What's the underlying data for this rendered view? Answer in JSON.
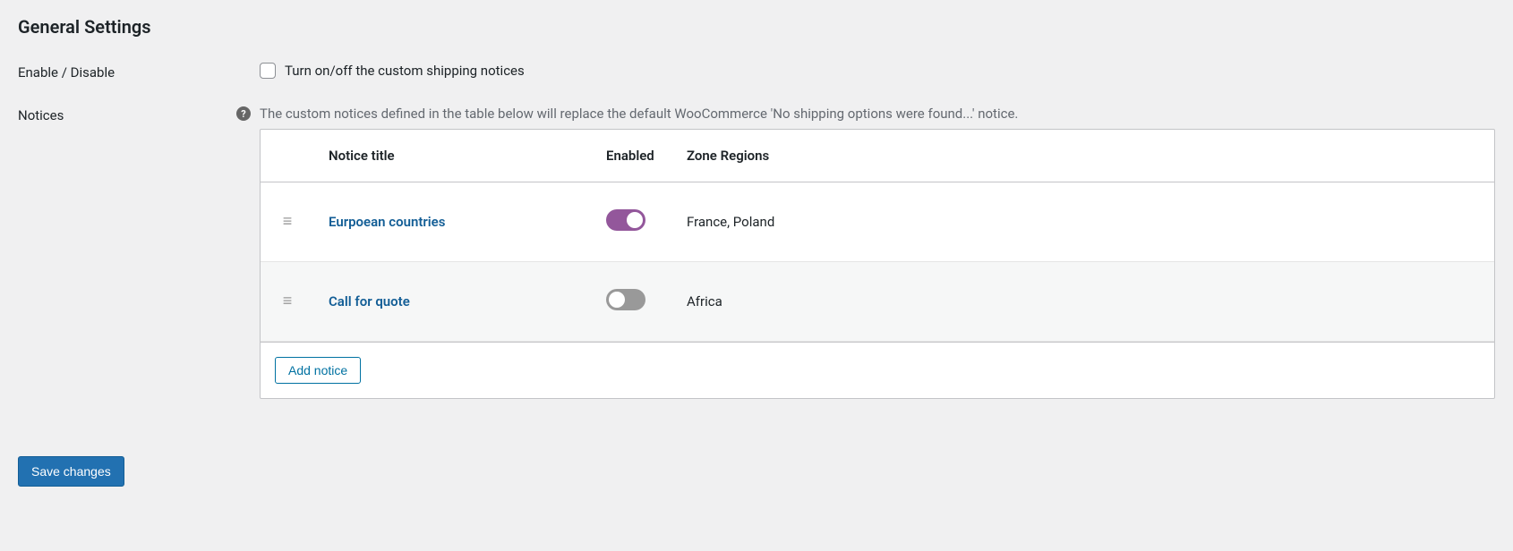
{
  "section_title": "General Settings",
  "enable_row": {
    "label": "Enable / Disable",
    "checkbox_label": "Turn on/off the custom shipping notices"
  },
  "notices_row": {
    "label": "Notices",
    "help_text": "The custom notices defined in the table below will replace the default WooCommerce 'No shipping options were found...' notice."
  },
  "table": {
    "headers": {
      "title": "Notice title",
      "enabled": "Enabled",
      "zone": "Zone Regions"
    },
    "rows": [
      {
        "title": "Eurpoean countries",
        "enabled": true,
        "zone": "France, Poland"
      },
      {
        "title": "Call for quote",
        "enabled": false,
        "zone": "Africa"
      }
    ]
  },
  "buttons": {
    "add_notice": "Add notice",
    "save": "Save changes"
  }
}
